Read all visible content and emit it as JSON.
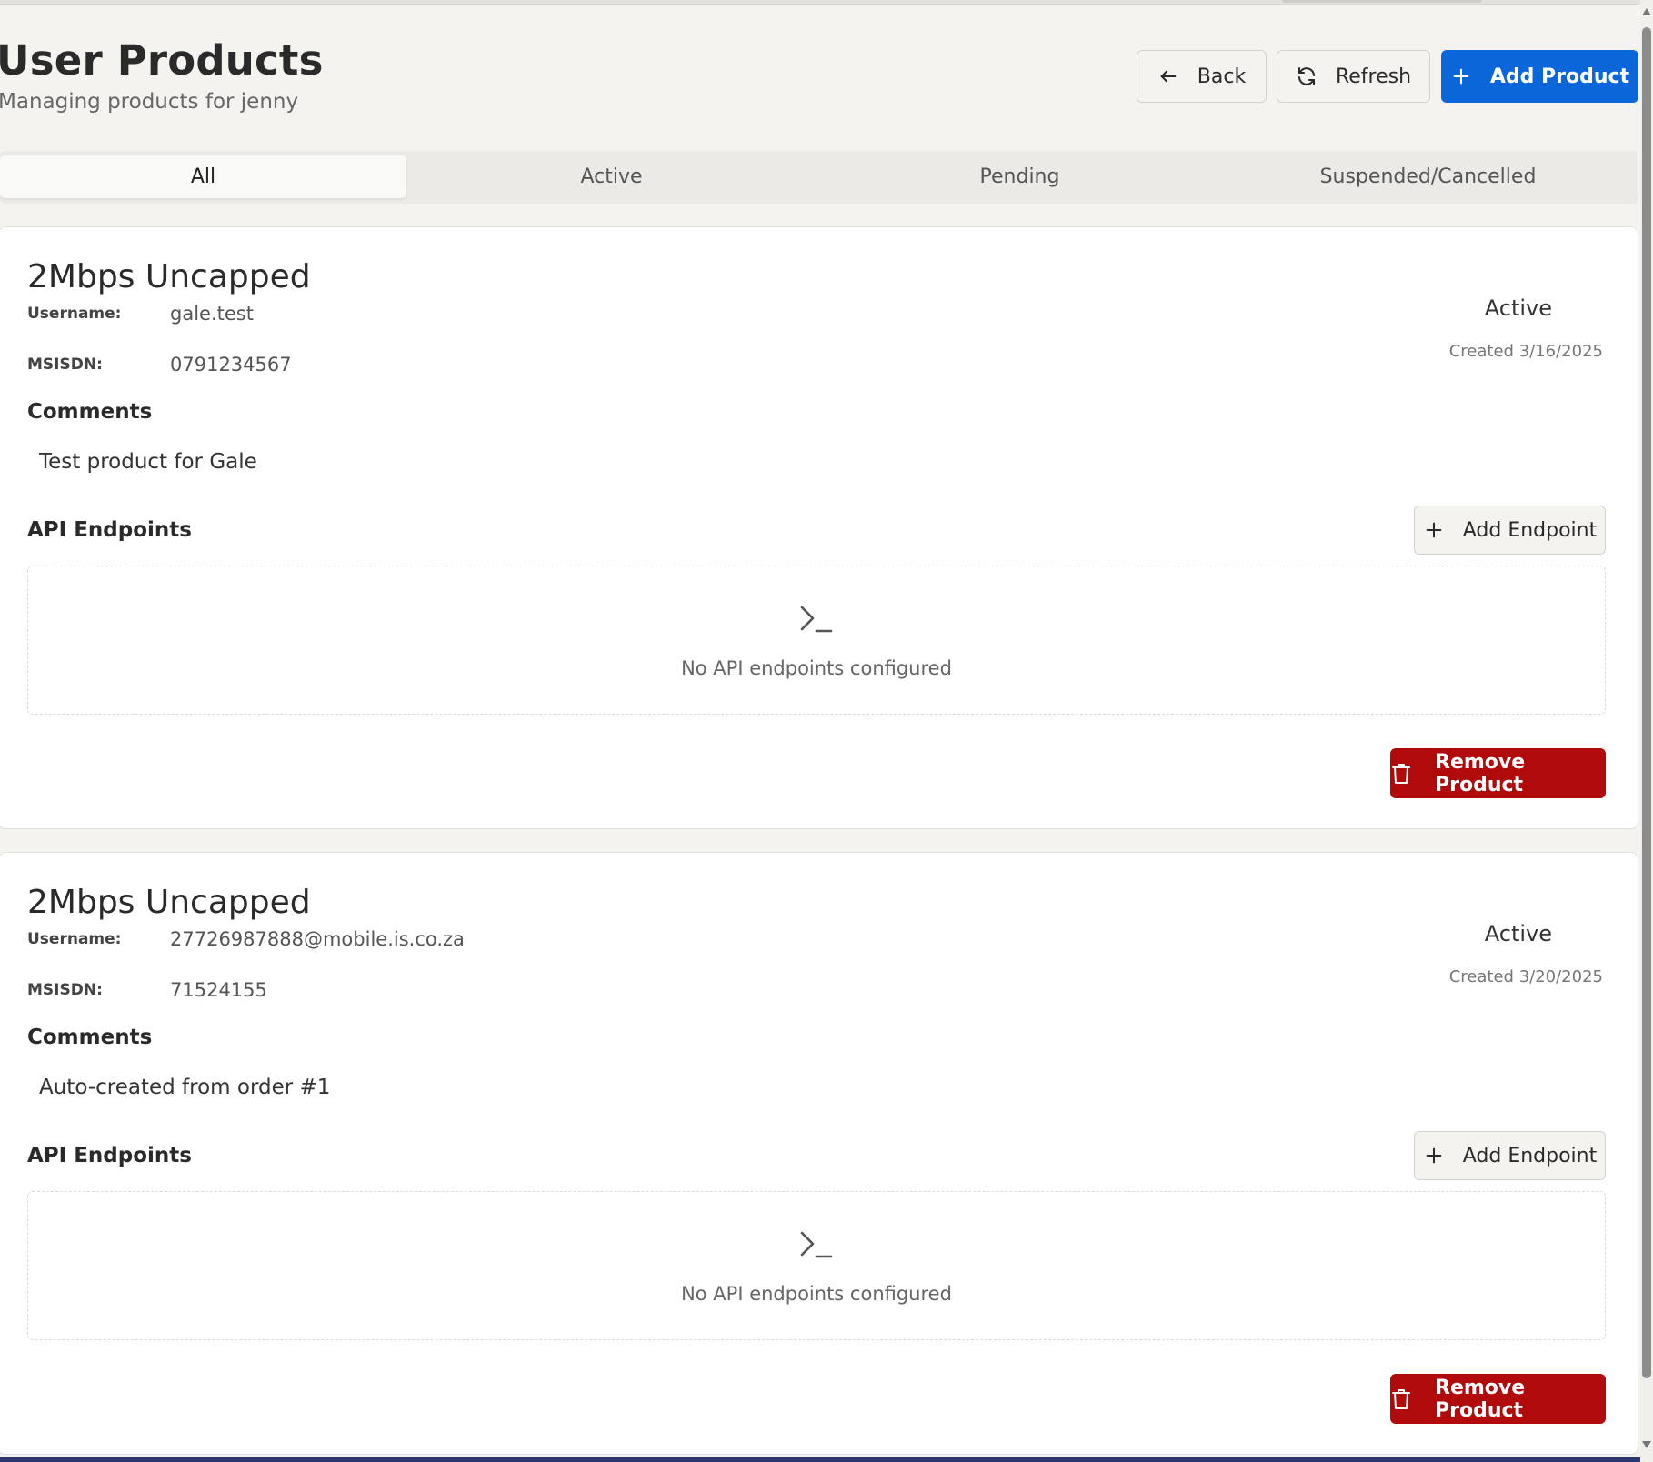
{
  "header": {
    "title": "User Products",
    "subtitle": "Managing products for jenny",
    "back_label": "Back",
    "refresh_label": "Refresh",
    "add_product_label": "Add Product"
  },
  "tabs": [
    {
      "label": "All",
      "selected": true
    },
    {
      "label": "Active",
      "selected": false
    },
    {
      "label": "Pending",
      "selected": false
    },
    {
      "label": "Suspended/Cancelled",
      "selected": false
    }
  ],
  "labels": {
    "username": "Username:",
    "msisdn": "MSISDN:",
    "comments": "Comments",
    "api_endpoints": "API Endpoints",
    "add_endpoint": "Add Endpoint",
    "no_endpoints": "No API endpoints configured",
    "remove_product": "Remove Product"
  },
  "products": [
    {
      "name": "2Mbps Uncapped",
      "username": "gale.test",
      "msisdn": "0791234567",
      "status": "Active",
      "created": "Created 3/16/2025",
      "comment": "Test product for Gale"
    },
    {
      "name": "2Mbps Uncapped",
      "username": "27726987888@mobile.is.co.za",
      "msisdn": "71524155",
      "status": "Active",
      "created": "Created 3/20/2025",
      "comment": "Auto-created from order #1"
    }
  ],
  "colors": {
    "primary": "#0a66d9",
    "danger": "#b00a0a",
    "background": "#f4f3f0"
  },
  "icons": {
    "back": "arrow-left-icon",
    "refresh": "refresh-icon",
    "add": "plus-icon",
    "terminal": "terminal-icon",
    "trash": "trash-icon"
  }
}
